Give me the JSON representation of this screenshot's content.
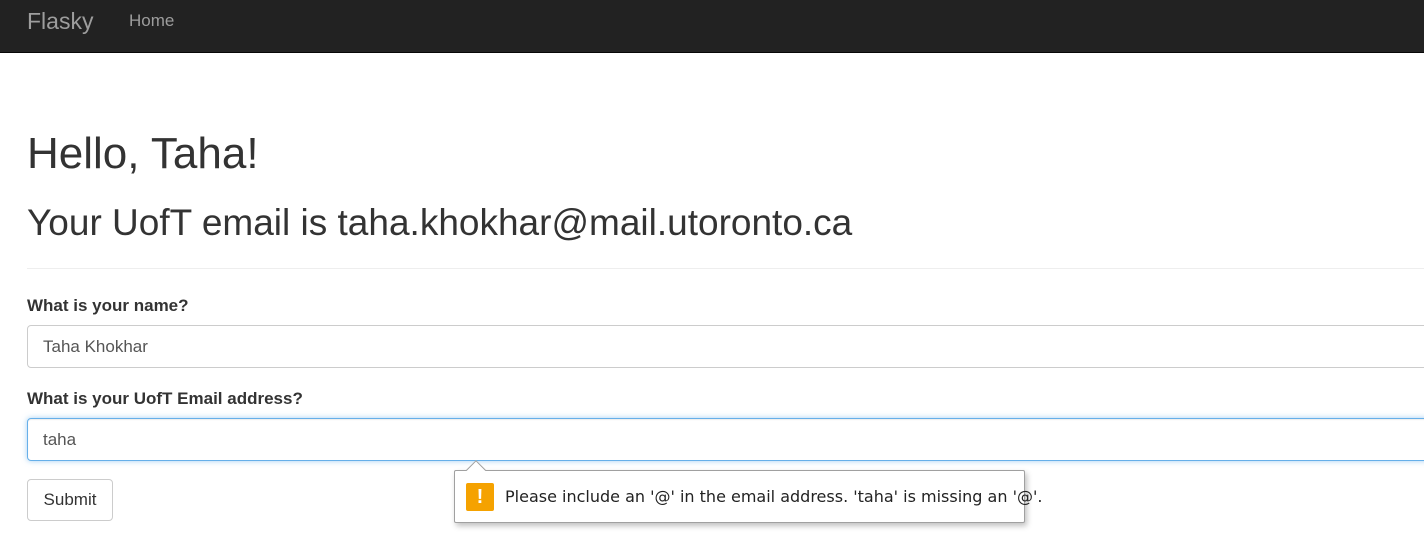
{
  "navbar": {
    "brand": "Flasky",
    "items": [
      {
        "label": "Home"
      }
    ]
  },
  "page": {
    "greeting": "Hello, Taha!",
    "email_message": "Your UofT email is taha.khokhar@mail.utoronto.ca"
  },
  "form": {
    "name_label": "What is your name?",
    "name_value": "Taha Khokhar",
    "email_label": "What is your UofT Email address?",
    "email_value": "taha",
    "submit_label": "Submit"
  },
  "validation_tooltip": {
    "icon": "warning-icon",
    "message": "Please include an '@' in the email address. 'taha' is missing an '@'.",
    "accent_color": "#f5a200"
  }
}
